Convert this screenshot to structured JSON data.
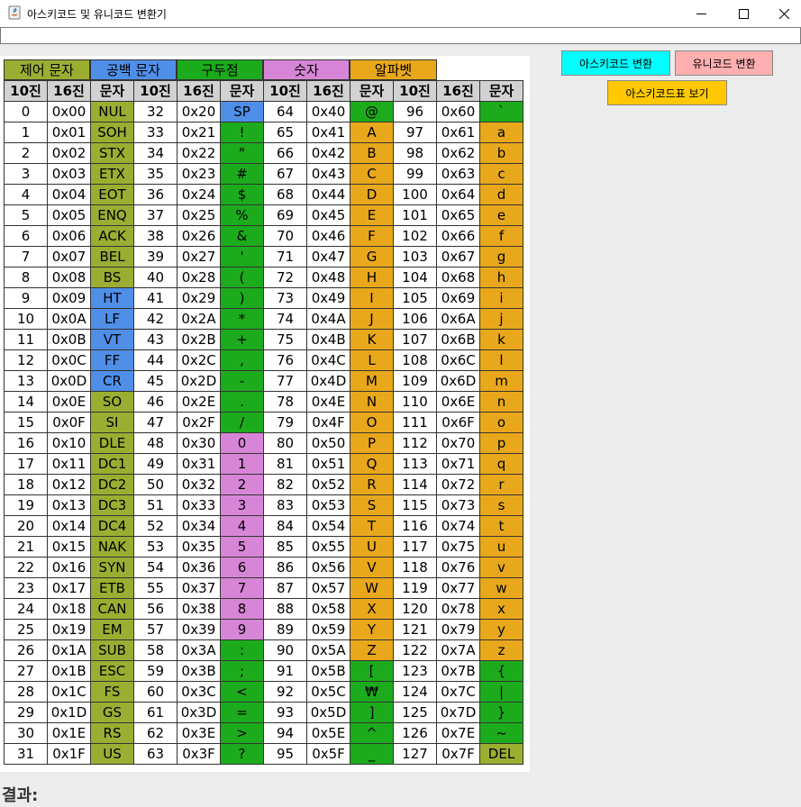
{
  "window": {
    "title": "아스키코드 및 유니코드 변환기"
  },
  "input": {
    "value": ""
  },
  "legend": [
    {
      "label": "제어 문자",
      "color": "#9bae32"
    },
    {
      "label": "공백 문자",
      "color": "#4f8fe8"
    },
    {
      "label": "구두점",
      "color": "#1cab1c"
    },
    {
      "label": "숫자",
      "color": "#d786d7"
    },
    {
      "label": "알파벳",
      "color": "#e9a81b"
    }
  ],
  "table": {
    "header": [
      "10진",
      "16진",
      "문자",
      "10진",
      "16진",
      "문자",
      "10진",
      "16진",
      "문자",
      "10진",
      "16진",
      "문자"
    ],
    "rows": [
      [
        "0",
        "0x00",
        "NUL",
        "32",
        "0x20",
        "SP",
        "64",
        "0x40",
        "@",
        "96",
        "0x60",
        "`"
      ],
      [
        "1",
        "0x01",
        "SOH",
        "33",
        "0x21",
        "!",
        "65",
        "0x41",
        "A",
        "97",
        "0x61",
        "a"
      ],
      [
        "2",
        "0x02",
        "STX",
        "34",
        "0x22",
        "\"",
        "66",
        "0x42",
        "B",
        "98",
        "0x62",
        "b"
      ],
      [
        "3",
        "0x03",
        "ETX",
        "35",
        "0x23",
        "#",
        "67",
        "0x43",
        "C",
        "99",
        "0x63",
        "c"
      ],
      [
        "4",
        "0x04",
        "EOT",
        "36",
        "0x24",
        "$",
        "68",
        "0x44",
        "D",
        "100",
        "0x64",
        "d"
      ],
      [
        "5",
        "0x05",
        "ENQ",
        "37",
        "0x25",
        "%",
        "69",
        "0x45",
        "E",
        "101",
        "0x65",
        "e"
      ],
      [
        "6",
        "0x06",
        "ACK",
        "38",
        "0x26",
        "&",
        "70",
        "0x46",
        "F",
        "102",
        "0x66",
        "f"
      ],
      [
        "7",
        "0x07",
        "BEL",
        "39",
        "0x27",
        "'",
        "71",
        "0x47",
        "G",
        "103",
        "0x67",
        "g"
      ],
      [
        "8",
        "0x08",
        "BS",
        "40",
        "0x28",
        "(",
        "72",
        "0x48",
        "H",
        "104",
        "0x68",
        "h"
      ],
      [
        "9",
        "0x09",
        "HT",
        "41",
        "0x29",
        ")",
        "73",
        "0x49",
        "I",
        "105",
        "0x69",
        "i"
      ],
      [
        "10",
        "0x0A",
        "LF",
        "42",
        "0x2A",
        "*",
        "74",
        "0x4A",
        "J",
        "106",
        "0x6A",
        "j"
      ],
      [
        "11",
        "0x0B",
        "VT",
        "43",
        "0x2B",
        "+",
        "75",
        "0x4B",
        "K",
        "107",
        "0x6B",
        "k"
      ],
      [
        "12",
        "0x0C",
        "FF",
        "44",
        "0x2C",
        ",",
        "76",
        "0x4C",
        "L",
        "108",
        "0x6C",
        "l"
      ],
      [
        "13",
        "0x0D",
        "CR",
        "45",
        "0x2D",
        "-",
        "77",
        "0x4D",
        "M",
        "109",
        "0x6D",
        "m"
      ],
      [
        "14",
        "0x0E",
        "SO",
        "46",
        "0x2E",
        ".",
        "78",
        "0x4E",
        "N",
        "110",
        "0x6E",
        "n"
      ],
      [
        "15",
        "0x0F",
        "SI",
        "47",
        "0x2F",
        "/",
        "79",
        "0x4F",
        "O",
        "111",
        "0x6F",
        "o"
      ],
      [
        "16",
        "0x10",
        "DLE",
        "48",
        "0x30",
        "0",
        "80",
        "0x50",
        "P",
        "112",
        "0x70",
        "p"
      ],
      [
        "17",
        "0x11",
        "DC1",
        "49",
        "0x31",
        "1",
        "81",
        "0x51",
        "Q",
        "113",
        "0x71",
        "q"
      ],
      [
        "18",
        "0x12",
        "DC2",
        "50",
        "0x32",
        "2",
        "82",
        "0x52",
        "R",
        "114",
        "0x72",
        "r"
      ],
      [
        "19",
        "0x13",
        "DC3",
        "51",
        "0x33",
        "3",
        "83",
        "0x53",
        "S",
        "115",
        "0x73",
        "s"
      ],
      [
        "20",
        "0x14",
        "DC4",
        "52",
        "0x34",
        "4",
        "84",
        "0x54",
        "T",
        "116",
        "0x74",
        "t"
      ],
      [
        "21",
        "0x15",
        "NAK",
        "53",
        "0x35",
        "5",
        "85",
        "0x55",
        "U",
        "117",
        "0x75",
        "u"
      ],
      [
        "22",
        "0x16",
        "SYN",
        "54",
        "0x36",
        "6",
        "86",
        "0x56",
        "V",
        "118",
        "0x76",
        "v"
      ],
      [
        "23",
        "0x17",
        "ETB",
        "55",
        "0x37",
        "7",
        "87",
        "0x57",
        "W",
        "119",
        "0x77",
        "w"
      ],
      [
        "24",
        "0x18",
        "CAN",
        "56",
        "0x38",
        "8",
        "88",
        "0x58",
        "X",
        "120",
        "0x78",
        "x"
      ],
      [
        "25",
        "0x19",
        "EM",
        "57",
        "0x39",
        "9",
        "89",
        "0x59",
        "Y",
        "121",
        "0x79",
        "y"
      ],
      [
        "26",
        "0x1A",
        "SUB",
        "58",
        "0x3A",
        ":",
        "90",
        "0x5A",
        "Z",
        "122",
        "0x7A",
        "z"
      ],
      [
        "27",
        "0x1B",
        "ESC",
        "59",
        "0x3B",
        ";",
        "91",
        "0x5B",
        "[",
        "123",
        "0x7B",
        "{"
      ],
      [
        "28",
        "0x1C",
        "FS",
        "60",
        "0x3C",
        "<",
        "92",
        "0x5C",
        "₩",
        "124",
        "0x7C",
        "|"
      ],
      [
        "29",
        "0x1D",
        "GS",
        "61",
        "0x3D",
        "=",
        "93",
        "0x5D",
        "]",
        "125",
        "0x7D",
        "}"
      ],
      [
        "30",
        "0x1E",
        "RS",
        "62",
        "0x3E",
        ">",
        "94",
        "0x5E",
        "^",
        "126",
        "0x7E",
        "~"
      ],
      [
        "31",
        "0x1F",
        "US",
        "63",
        "0x3F",
        "?",
        "95",
        "0x5F",
        "_",
        "127",
        "0x7F",
        "DEL"
      ]
    ]
  },
  "buttons": {
    "ascii_convert": {
      "label": "아스키코드 변환",
      "color": "#00ffff"
    },
    "unicode_convert": {
      "label": "유니코드 변환",
      "color": "#ffafaf"
    },
    "show_table": {
      "label": "아스키코드표 보기",
      "color": "#ffc800"
    }
  },
  "result": {
    "label": "결과:"
  }
}
